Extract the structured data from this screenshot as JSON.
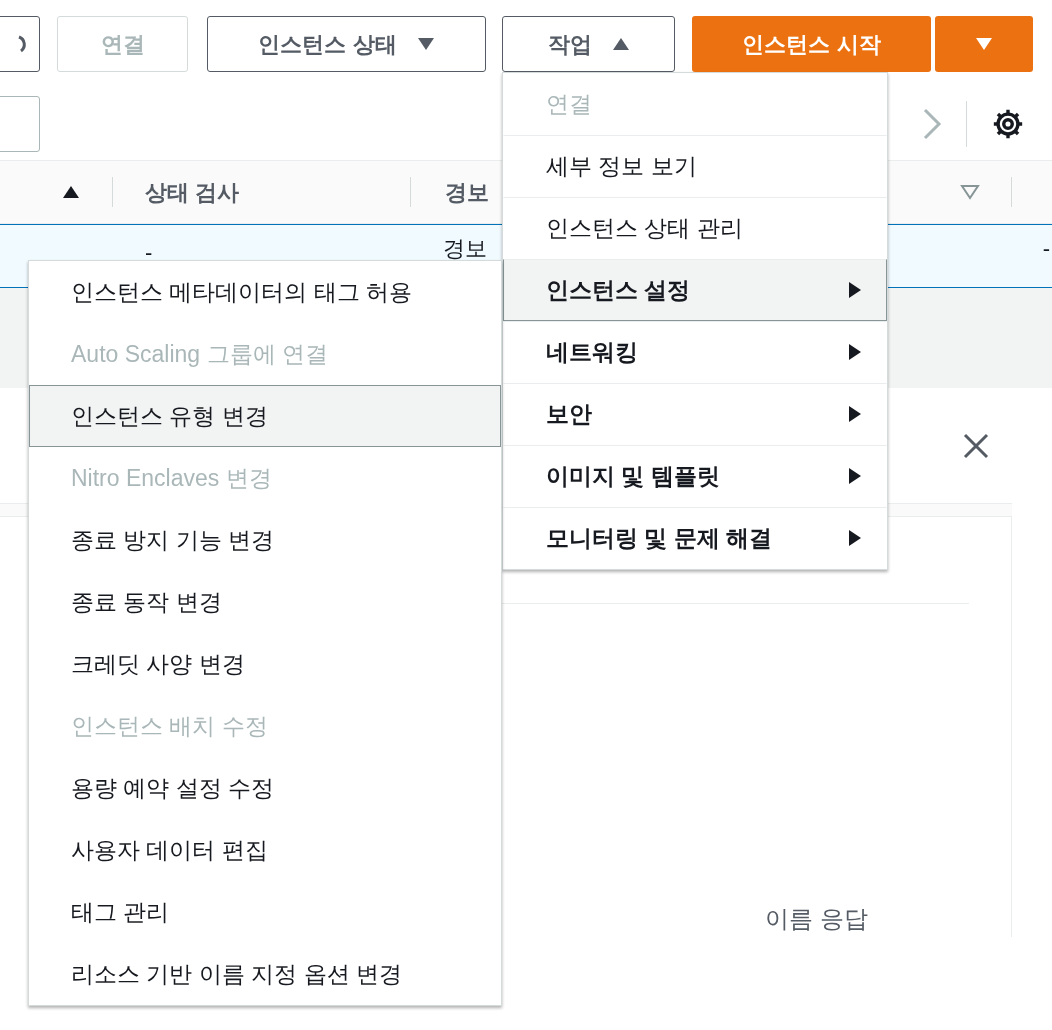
{
  "toolbar": {
    "buttons": [
      {
        "label": "연결",
        "kind": "plain",
        "disabled": true
      },
      {
        "label": "인스턴스 상태",
        "kind": "dropdown",
        "expanded": false,
        "disabled": false
      },
      {
        "label": "작업",
        "kind": "dropdown",
        "expanded": true,
        "disabled": false
      },
      {
        "label": "인스턴스 시작",
        "kind": "primary",
        "disabled": false
      },
      {
        "kind": "split",
        "expanded": false,
        "disabled": false
      }
    ]
  },
  "table": {
    "columns": [
      {
        "label": "상태 검사"
      },
      {
        "label": "경보"
      }
    ],
    "rows": [
      {
        "selected": true,
        "cells": [
          "-",
          "경보"
        ],
        "overflow_cell": "-"
      }
    ]
  },
  "details": {
    "text": "이름 응답"
  },
  "actions_menu": {
    "items": [
      {
        "label": "연결",
        "kind": "item",
        "disabled": true,
        "selected": false
      },
      {
        "label": "세부 정보 보기",
        "kind": "item",
        "disabled": false,
        "selected": false
      },
      {
        "label": "인스턴스 상태 관리",
        "kind": "item",
        "disabled": false,
        "selected": false
      },
      {
        "label": "인스턴스 설정",
        "kind": "submenu",
        "disabled": false,
        "selected": true
      },
      {
        "label": "네트워킹",
        "kind": "submenu",
        "disabled": false,
        "selected": false
      },
      {
        "label": "보안",
        "kind": "submenu",
        "disabled": false,
        "selected": false
      },
      {
        "label": "이미지 및 템플릿",
        "kind": "submenu",
        "disabled": false,
        "selected": false
      },
      {
        "label": "모니터링 및 문제 해결",
        "kind": "submenu",
        "disabled": false,
        "selected": false
      }
    ]
  },
  "settings_submenu": {
    "items": [
      {
        "label": "인스턴스 메타데이터의 태그 허용",
        "disabled": false,
        "selected": false
      },
      {
        "label": "Auto Scaling 그룹에 연결",
        "disabled": true,
        "selected": false
      },
      {
        "label": "인스턴스 유형 변경",
        "disabled": false,
        "selected": true
      },
      {
        "label": "Nitro Enclaves 변경",
        "disabled": true,
        "selected": false
      },
      {
        "label": "종료 방지 기능 변경",
        "disabled": false,
        "selected": false
      },
      {
        "label": "종료 동작 변경",
        "disabled": false,
        "selected": false
      },
      {
        "label": "크레딧 사양 변경",
        "disabled": false,
        "selected": false
      },
      {
        "label": "인스턴스 배치 수정",
        "disabled": true,
        "selected": false
      },
      {
        "label": "용량 예약 설정 수정",
        "disabled": false,
        "selected": false
      },
      {
        "label": "사용자 데이터 편집",
        "disabled": false,
        "selected": false
      },
      {
        "label": "태그 관리",
        "disabled": false,
        "selected": false
      },
      {
        "label": "리소스 기반 이름 지정 옵션 변경",
        "disabled": false,
        "selected": false
      }
    ]
  }
}
